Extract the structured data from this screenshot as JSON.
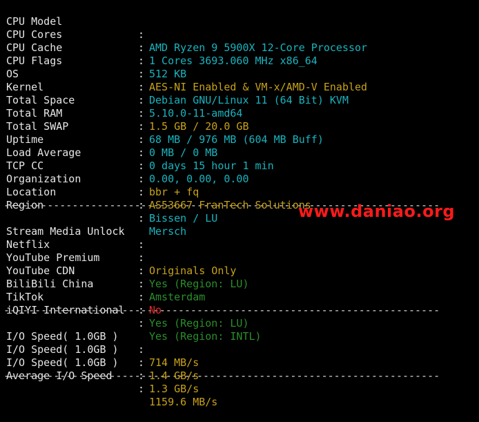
{
  "system": [
    {
      "key": "CPU Model",
      "value": "AMD Ryzen 9 5900X 12-Core Processor",
      "color": "cyan"
    },
    {
      "key": "CPU Cores",
      "value": "1 Cores 3693.060 MHz x86_64",
      "color": "cyan"
    },
    {
      "key": "CPU Cache",
      "value": "512 KB",
      "color": "cyan"
    },
    {
      "key": "CPU Flags",
      "value": "AES-NI Enabled & VM-x/AMD-V Enabled",
      "color": "yellow"
    },
    {
      "key": "OS",
      "value": "Debian GNU/Linux 11 (64 Bit) KVM",
      "color": "cyan"
    },
    {
      "key": "Kernel",
      "value": "5.10.0-11-amd64",
      "color": "cyan"
    },
    {
      "key": "Total Space",
      "value": "1.5 GB / 20.0 GB",
      "color": "yellow"
    },
    {
      "key": "Total RAM",
      "value": "68 MB / 976 MB (604 MB Buff)",
      "color": "cyan"
    },
    {
      "key": "Total SWAP",
      "value": "0 MB / 0 MB",
      "color": "cyan"
    },
    {
      "key": "Uptime",
      "value": "0 days 15 hour 1 min",
      "color": "cyan"
    },
    {
      "key": "Load Average",
      "value": "0.00, 0.00, 0.00",
      "color": "cyan"
    },
    {
      "key": "TCP CC",
      "value": "bbr + fq",
      "color": "yellow"
    },
    {
      "key": "Organization",
      "value": "AS53667 FranTech Solutions",
      "color": "yellow"
    },
    {
      "key": "Location",
      "value": "Bissen / LU",
      "color": "cyan"
    },
    {
      "key": "Region",
      "value": "Mersch",
      "color": "cyan"
    }
  ],
  "divider": "----------------------------------------------------------------------",
  "media": {
    "header": "Stream Media Unlock",
    "items": [
      {
        "key": "Netflix",
        "value": "Originals Only",
        "color": "yellow"
      },
      {
        "key": "YouTube Premium",
        "value": "Yes (Region: LU)",
        "color": "green"
      },
      {
        "key": "YouTube CDN",
        "value": "Amsterdam",
        "color": "green"
      },
      {
        "key": "BiliBili China",
        "value": "No",
        "color": "red"
      },
      {
        "key": "TikTok",
        "value": "Yes (Region: LU)",
        "color": "green"
      },
      {
        "key": "iQIYI International",
        "value": "Yes (Region: INTL)",
        "color": "green"
      }
    ]
  },
  "io": [
    {
      "key": "I/O Speed( 1.0GB )",
      "value": "714 MB/s",
      "color": "yellow"
    },
    {
      "key": "I/O Speed( 1.0GB )",
      "value": "1.4 GB/s",
      "color": "yellow"
    },
    {
      "key": "I/O Speed( 1.0GB )",
      "value": "1.3 GB/s",
      "color": "yellow"
    },
    {
      "key": "Average I/O Speed",
      "value": "1159.6 MB/s",
      "color": "yellow"
    }
  ],
  "colon": ":",
  "watermark": "www.daniao.org",
  "colors": {
    "background": "#000000",
    "cyan": "#18b4bf",
    "yellow": "#c7a21a",
    "green": "#2a8f2a",
    "red": "#e02a2a",
    "watermark": "#ff1a1a"
  }
}
